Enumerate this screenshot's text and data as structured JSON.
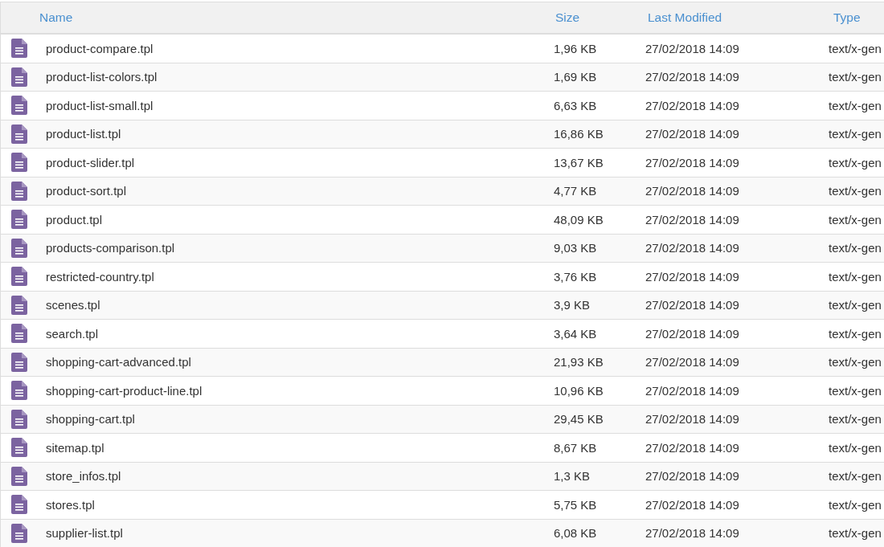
{
  "table": {
    "columns": [
      "Name",
      "Size",
      "Last Modified",
      "Type"
    ],
    "rows": [
      {
        "name": "product-compare.tpl",
        "size": "1,96 KB",
        "modified": "27/02/2018 14:09",
        "type": "text/x-gen"
      },
      {
        "name": "product-list-colors.tpl",
        "size": "1,69 KB",
        "modified": "27/02/2018 14:09",
        "type": "text/x-gen"
      },
      {
        "name": "product-list-small.tpl",
        "size": "6,63 KB",
        "modified": "27/02/2018 14:09",
        "type": "text/x-gen"
      },
      {
        "name": "product-list.tpl",
        "size": "16,86 KB",
        "modified": "27/02/2018 14:09",
        "type": "text/x-gen"
      },
      {
        "name": "product-slider.tpl",
        "size": "13,67 KB",
        "modified": "27/02/2018 14:09",
        "type": "text/x-gen"
      },
      {
        "name": "product-sort.tpl",
        "size": "4,77 KB",
        "modified": "27/02/2018 14:09",
        "type": "text/x-gen"
      },
      {
        "name": "product.tpl",
        "size": "48,09 KB",
        "modified": "27/02/2018 14:09",
        "type": "text/x-gen"
      },
      {
        "name": "products-comparison.tpl",
        "size": "9,03 KB",
        "modified": "27/02/2018 14:09",
        "type": "text/x-gen"
      },
      {
        "name": "restricted-country.tpl",
        "size": "3,76 KB",
        "modified": "27/02/2018 14:09",
        "type": "text/x-gen"
      },
      {
        "name": "scenes.tpl",
        "size": "3,9 KB",
        "modified": "27/02/2018 14:09",
        "type": "text/x-gen"
      },
      {
        "name": "search.tpl",
        "size": "3,64 KB",
        "modified": "27/02/2018 14:09",
        "type": "text/x-gen"
      },
      {
        "name": "shopping-cart-advanced.tpl",
        "size": "21,93 KB",
        "modified": "27/02/2018 14:09",
        "type": "text/x-gen"
      },
      {
        "name": "shopping-cart-product-line.tpl",
        "size": "10,96 KB",
        "modified": "27/02/2018 14:09",
        "type": "text/x-gen"
      },
      {
        "name": "shopping-cart.tpl",
        "size": "29,45 KB",
        "modified": "27/02/2018 14:09",
        "type": "text/x-gen"
      },
      {
        "name": "sitemap.tpl",
        "size": "8,67 KB",
        "modified": "27/02/2018 14:09",
        "type": "text/x-gen"
      },
      {
        "name": "store_infos.tpl",
        "size": "1,3 KB",
        "modified": "27/02/2018 14:09",
        "type": "text/x-gen"
      },
      {
        "name": "stores.tpl",
        "size": "5,75 KB",
        "modified": "27/02/2018 14:09",
        "type": "text/x-gen"
      },
      {
        "name": "supplier-list.tpl",
        "size": "6,08 KB",
        "modified": "27/02/2018 14:09",
        "type": "text/x-gen"
      }
    ]
  }
}
